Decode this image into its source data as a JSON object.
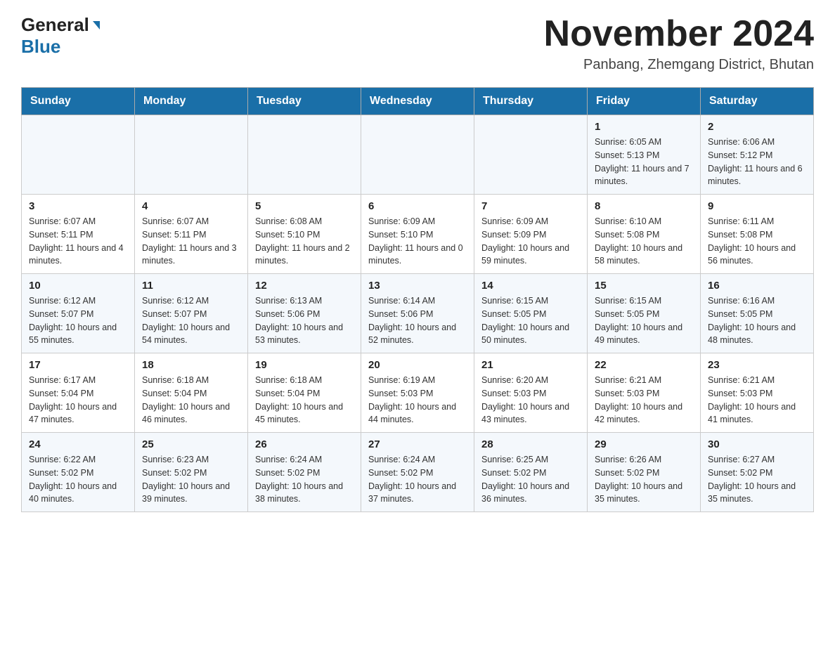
{
  "header": {
    "logo_general": "General",
    "logo_blue": "Blue",
    "month_title": "November 2024",
    "location": "Panbang, Zhemgang District, Bhutan"
  },
  "days_of_week": [
    "Sunday",
    "Monday",
    "Tuesday",
    "Wednesday",
    "Thursday",
    "Friday",
    "Saturday"
  ],
  "weeks": [
    {
      "cells": [
        {
          "day": "",
          "sunrise": "",
          "sunset": "",
          "daylight": ""
        },
        {
          "day": "",
          "sunrise": "",
          "sunset": "",
          "daylight": ""
        },
        {
          "day": "",
          "sunrise": "",
          "sunset": "",
          "daylight": ""
        },
        {
          "day": "",
          "sunrise": "",
          "sunset": "",
          "daylight": ""
        },
        {
          "day": "",
          "sunrise": "",
          "sunset": "",
          "daylight": ""
        },
        {
          "day": "1",
          "sunrise": "Sunrise: 6:05 AM",
          "sunset": "Sunset: 5:13 PM",
          "daylight": "Daylight: 11 hours and 7 minutes."
        },
        {
          "day": "2",
          "sunrise": "Sunrise: 6:06 AM",
          "sunset": "Sunset: 5:12 PM",
          "daylight": "Daylight: 11 hours and 6 minutes."
        }
      ]
    },
    {
      "cells": [
        {
          "day": "3",
          "sunrise": "Sunrise: 6:07 AM",
          "sunset": "Sunset: 5:11 PM",
          "daylight": "Daylight: 11 hours and 4 minutes."
        },
        {
          "day": "4",
          "sunrise": "Sunrise: 6:07 AM",
          "sunset": "Sunset: 5:11 PM",
          "daylight": "Daylight: 11 hours and 3 minutes."
        },
        {
          "day": "5",
          "sunrise": "Sunrise: 6:08 AM",
          "sunset": "Sunset: 5:10 PM",
          "daylight": "Daylight: 11 hours and 2 minutes."
        },
        {
          "day": "6",
          "sunrise": "Sunrise: 6:09 AM",
          "sunset": "Sunset: 5:10 PM",
          "daylight": "Daylight: 11 hours and 0 minutes."
        },
        {
          "day": "7",
          "sunrise": "Sunrise: 6:09 AM",
          "sunset": "Sunset: 5:09 PM",
          "daylight": "Daylight: 10 hours and 59 minutes."
        },
        {
          "day": "8",
          "sunrise": "Sunrise: 6:10 AM",
          "sunset": "Sunset: 5:08 PM",
          "daylight": "Daylight: 10 hours and 58 minutes."
        },
        {
          "day": "9",
          "sunrise": "Sunrise: 6:11 AM",
          "sunset": "Sunset: 5:08 PM",
          "daylight": "Daylight: 10 hours and 56 minutes."
        }
      ]
    },
    {
      "cells": [
        {
          "day": "10",
          "sunrise": "Sunrise: 6:12 AM",
          "sunset": "Sunset: 5:07 PM",
          "daylight": "Daylight: 10 hours and 55 minutes."
        },
        {
          "day": "11",
          "sunrise": "Sunrise: 6:12 AM",
          "sunset": "Sunset: 5:07 PM",
          "daylight": "Daylight: 10 hours and 54 minutes."
        },
        {
          "day": "12",
          "sunrise": "Sunrise: 6:13 AM",
          "sunset": "Sunset: 5:06 PM",
          "daylight": "Daylight: 10 hours and 53 minutes."
        },
        {
          "day": "13",
          "sunrise": "Sunrise: 6:14 AM",
          "sunset": "Sunset: 5:06 PM",
          "daylight": "Daylight: 10 hours and 52 minutes."
        },
        {
          "day": "14",
          "sunrise": "Sunrise: 6:15 AM",
          "sunset": "Sunset: 5:05 PM",
          "daylight": "Daylight: 10 hours and 50 minutes."
        },
        {
          "day": "15",
          "sunrise": "Sunrise: 6:15 AM",
          "sunset": "Sunset: 5:05 PM",
          "daylight": "Daylight: 10 hours and 49 minutes."
        },
        {
          "day": "16",
          "sunrise": "Sunrise: 6:16 AM",
          "sunset": "Sunset: 5:05 PM",
          "daylight": "Daylight: 10 hours and 48 minutes."
        }
      ]
    },
    {
      "cells": [
        {
          "day": "17",
          "sunrise": "Sunrise: 6:17 AM",
          "sunset": "Sunset: 5:04 PM",
          "daylight": "Daylight: 10 hours and 47 minutes."
        },
        {
          "day": "18",
          "sunrise": "Sunrise: 6:18 AM",
          "sunset": "Sunset: 5:04 PM",
          "daylight": "Daylight: 10 hours and 46 minutes."
        },
        {
          "day": "19",
          "sunrise": "Sunrise: 6:18 AM",
          "sunset": "Sunset: 5:04 PM",
          "daylight": "Daylight: 10 hours and 45 minutes."
        },
        {
          "day": "20",
          "sunrise": "Sunrise: 6:19 AM",
          "sunset": "Sunset: 5:03 PM",
          "daylight": "Daylight: 10 hours and 44 minutes."
        },
        {
          "day": "21",
          "sunrise": "Sunrise: 6:20 AM",
          "sunset": "Sunset: 5:03 PM",
          "daylight": "Daylight: 10 hours and 43 minutes."
        },
        {
          "day": "22",
          "sunrise": "Sunrise: 6:21 AM",
          "sunset": "Sunset: 5:03 PM",
          "daylight": "Daylight: 10 hours and 42 minutes."
        },
        {
          "day": "23",
          "sunrise": "Sunrise: 6:21 AM",
          "sunset": "Sunset: 5:03 PM",
          "daylight": "Daylight: 10 hours and 41 minutes."
        }
      ]
    },
    {
      "cells": [
        {
          "day": "24",
          "sunrise": "Sunrise: 6:22 AM",
          "sunset": "Sunset: 5:02 PM",
          "daylight": "Daylight: 10 hours and 40 minutes."
        },
        {
          "day": "25",
          "sunrise": "Sunrise: 6:23 AM",
          "sunset": "Sunset: 5:02 PM",
          "daylight": "Daylight: 10 hours and 39 minutes."
        },
        {
          "day": "26",
          "sunrise": "Sunrise: 6:24 AM",
          "sunset": "Sunset: 5:02 PM",
          "daylight": "Daylight: 10 hours and 38 minutes."
        },
        {
          "day": "27",
          "sunrise": "Sunrise: 6:24 AM",
          "sunset": "Sunset: 5:02 PM",
          "daylight": "Daylight: 10 hours and 37 minutes."
        },
        {
          "day": "28",
          "sunrise": "Sunrise: 6:25 AM",
          "sunset": "Sunset: 5:02 PM",
          "daylight": "Daylight: 10 hours and 36 minutes."
        },
        {
          "day": "29",
          "sunrise": "Sunrise: 6:26 AM",
          "sunset": "Sunset: 5:02 PM",
          "daylight": "Daylight: 10 hours and 35 minutes."
        },
        {
          "day": "30",
          "sunrise": "Sunrise: 6:27 AM",
          "sunset": "Sunset: 5:02 PM",
          "daylight": "Daylight: 10 hours and 35 minutes."
        }
      ]
    }
  ]
}
